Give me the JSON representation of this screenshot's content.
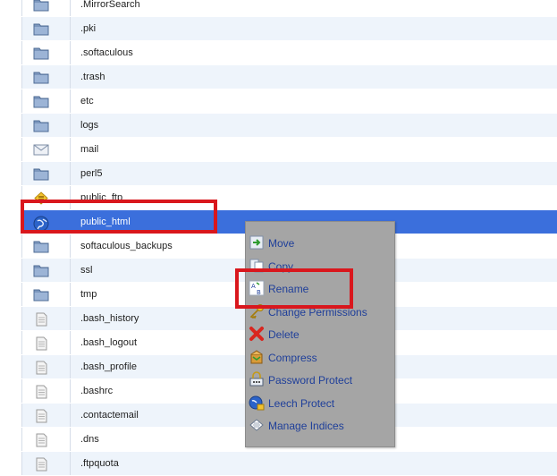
{
  "files": [
    {
      "name": ".MirrorSearch",
      "icon": "folder-icon"
    },
    {
      "name": ".pki",
      "icon": "folder-icon"
    },
    {
      "name": ".softaculous",
      "icon": "folder-icon"
    },
    {
      "name": ".trash",
      "icon": "folder-icon"
    },
    {
      "name": "etc",
      "icon": "folder-icon"
    },
    {
      "name": "logs",
      "icon": "folder-icon"
    },
    {
      "name": "mail",
      "icon": "mail-folder-icon"
    },
    {
      "name": "perl5",
      "icon": "folder-icon"
    },
    {
      "name": "public_ftp",
      "icon": "ftp-folder-icon"
    },
    {
      "name": "public_html",
      "icon": "web-globe-icon",
      "selected": true
    },
    {
      "name": "softaculous_backups",
      "icon": "folder-icon"
    },
    {
      "name": "ssl",
      "icon": "folder-icon"
    },
    {
      "name": "tmp",
      "icon": "folder-icon"
    },
    {
      "name": ".bash_history",
      "icon": "text-file-icon"
    },
    {
      "name": ".bash_logout",
      "icon": "text-file-icon"
    },
    {
      "name": ".bash_profile",
      "icon": "text-file-icon"
    },
    {
      "name": ".bashrc",
      "icon": "text-file-icon"
    },
    {
      "name": ".contactemail",
      "icon": "text-file-icon"
    },
    {
      "name": ".dns",
      "icon": "text-file-icon"
    },
    {
      "name": ".ftpquota",
      "icon": "text-file-icon"
    }
  ],
  "context_menu": {
    "items": [
      {
        "label": "Move",
        "icon": "move-icon"
      },
      {
        "label": "Copy",
        "icon": "copy-icon"
      },
      {
        "label": "Rename",
        "icon": "rename-icon"
      },
      {
        "label": "Change Permissions",
        "icon": "key-icon"
      },
      {
        "label": "Delete",
        "icon": "delete-icon"
      },
      {
        "label": "Compress",
        "icon": "compress-icon"
      },
      {
        "label": "Password Protect",
        "icon": "password-protect-icon"
      },
      {
        "label": "Leech Protect",
        "icon": "leech-protect-icon"
      },
      {
        "label": "Manage Indices",
        "icon": "manage-indices-icon"
      }
    ]
  },
  "colors": {
    "selected_row": "#3b6fdc",
    "highlight_box": "#d9171d",
    "menu_background": "#a5a5a5",
    "menu_text": "#1f3f9a"
  }
}
